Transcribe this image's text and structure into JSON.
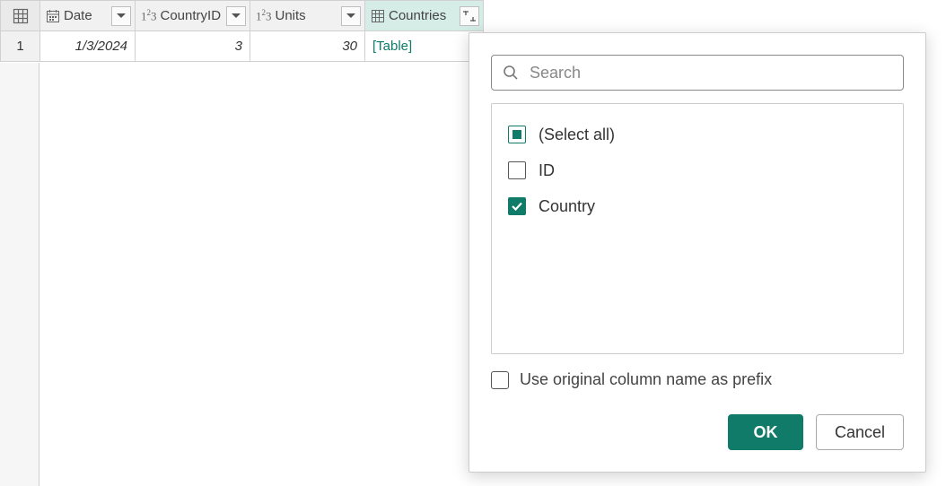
{
  "columns": {
    "date": {
      "label": "Date"
    },
    "countryid": {
      "label": "CountryID"
    },
    "units": {
      "label": "Units"
    },
    "countries": {
      "label": "Countries"
    }
  },
  "row": {
    "index": "1",
    "date": "1/3/2024",
    "countryid": "3",
    "units": "30",
    "countries": "[Table]"
  },
  "popup": {
    "search_placeholder": "Search",
    "select_all": "(Select all)",
    "options": {
      "id": "ID",
      "country": "Country"
    },
    "prefix_label": "Use original column name as prefix",
    "ok": "OK",
    "cancel": "Cancel"
  }
}
